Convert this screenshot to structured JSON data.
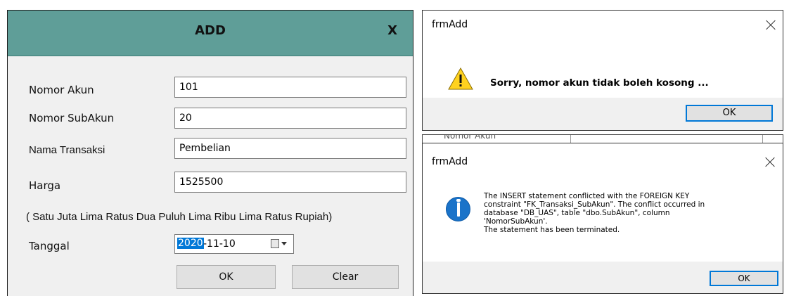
{
  "add_form": {
    "title": "ADD",
    "close_label": "X",
    "fields": [
      {
        "label": "Nomor Akun",
        "value": "101"
      },
      {
        "label": "Nomor SubAkun",
        "value": "20"
      },
      {
        "label": "Nama Transaksi",
        "value": "Pembelian"
      },
      {
        "label": "Harga",
        "value": "1525500"
      }
    ],
    "terbilang": "( Satu Juta Lima Ratus Dua Puluh Lima Ribu Lima Ratus Rupiah)",
    "date": {
      "label": "Tanggal",
      "year": "2020",
      "rest": "-11-10"
    },
    "ok_label": "OK",
    "clear_label": "Clear"
  },
  "warning_dialog": {
    "title": "frmAdd",
    "message": "Sorry, nomor akun tidak boleh kosong ...",
    "ok_label": "OK",
    "icon": "warning-icon"
  },
  "behind_window": {
    "label": "Nomor Akun"
  },
  "error_dialog": {
    "title": "frmAdd",
    "lines": [
      "The INSERT statement conflicted with the FOREIGN KEY",
      "constraint \"FK_Transaksi_SubAkun\". The conflict occurred in",
      "database \"DB_UAS\", table \"dbo.SubAkun\", column",
      "'NomorSubAkun'.",
      "The statement has been terminated."
    ],
    "ok_label": "OK",
    "icon": "info-icon"
  },
  "colors": {
    "header": "#5f9e98",
    "accent": "#0078d7",
    "warning": "#ffd21f",
    "info": "#1a73c9"
  }
}
